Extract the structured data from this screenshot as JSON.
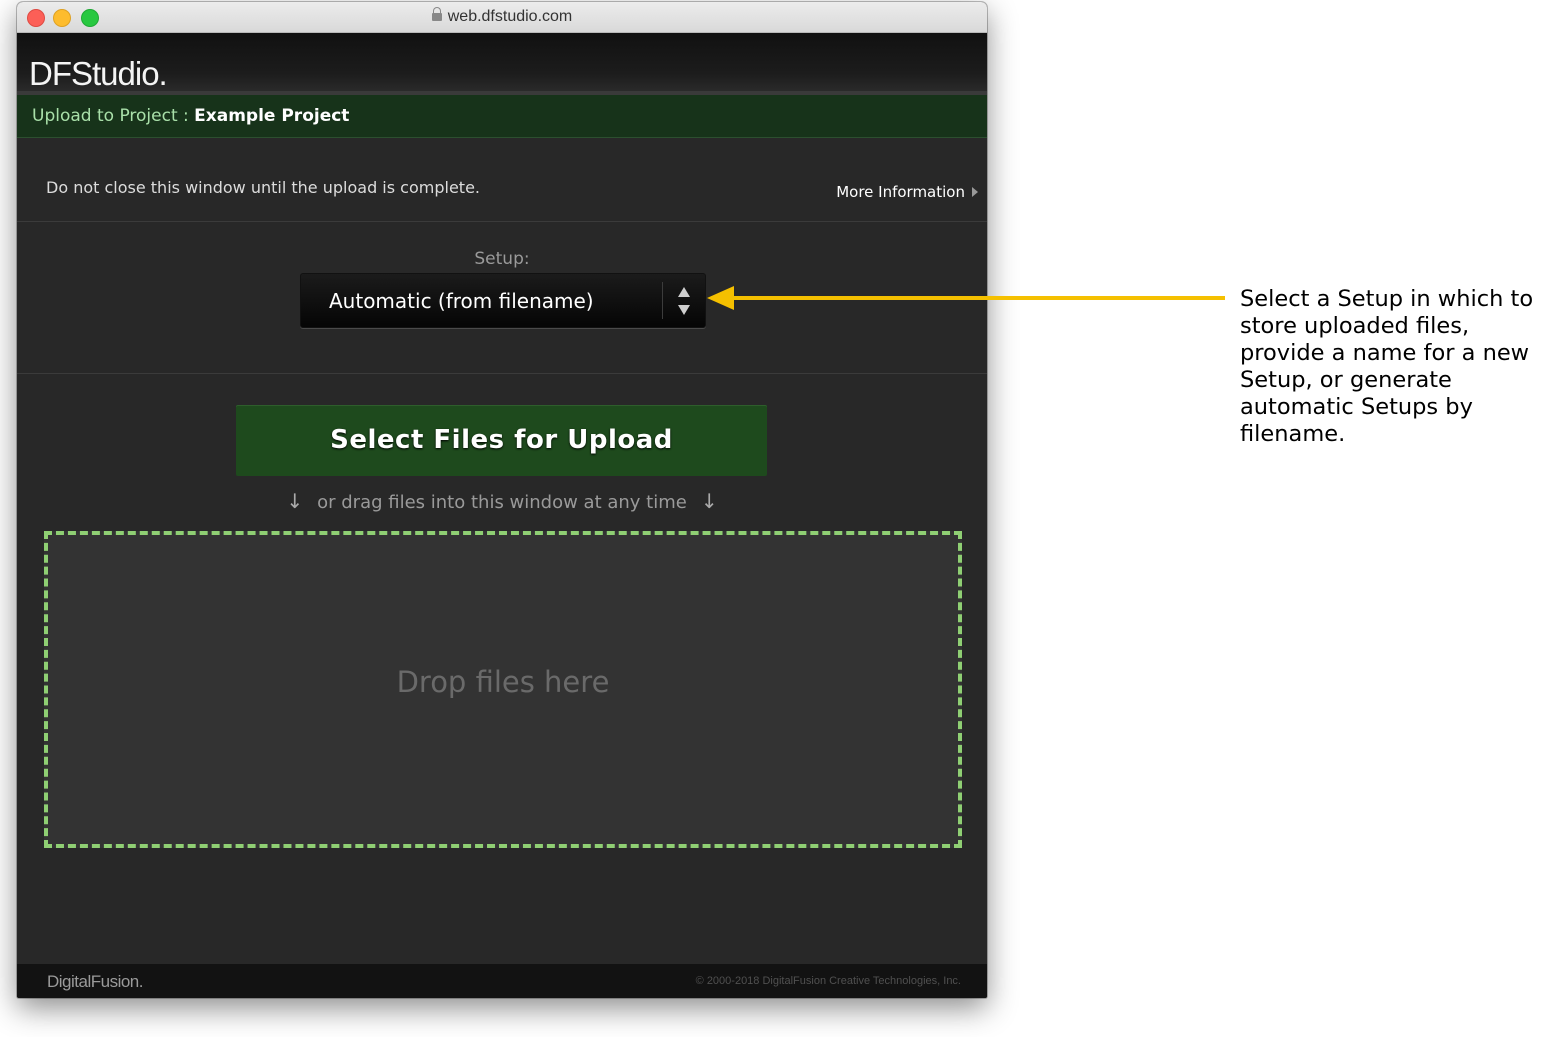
{
  "browser": {
    "url": "web.dfstudio.com"
  },
  "header": {
    "logo_text": "DFStudio."
  },
  "project_bar": {
    "label": "Upload to Project : ",
    "project_name": "Example Project"
  },
  "notice": {
    "text": "Do not close this window until the upload is complete.",
    "more_info_label": "More Information"
  },
  "setup": {
    "label": "Setup:",
    "selected_value": "Automatic (from filename)"
  },
  "upload": {
    "button_label": "Select Files for Upload",
    "drag_hint": "or drag files into this window at any time",
    "drop_zone_text": "Drop files here"
  },
  "footer": {
    "logo_text": "DigitalFusion.",
    "copyright": "© 2000-2018 DigitalFusion Creative Technologies, Inc."
  },
  "annotation": {
    "text": "Select a Setup in which to store uploaded files, provide a name for a new Setup, or generate automatic Setups by filename.",
    "color": "#f5c000"
  },
  "colors": {
    "project_bar_bg": "#17331a",
    "upload_button_bg": "#1e4a1d",
    "dropzone_border": "#8fcf73"
  }
}
